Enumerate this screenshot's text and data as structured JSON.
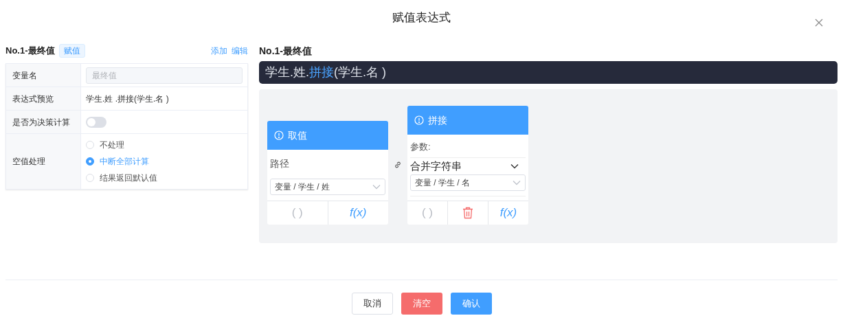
{
  "dialog": {
    "title": "赋值表达式"
  },
  "left": {
    "title": "No.1-最终值",
    "tag": "赋值",
    "actions": [
      "添加",
      "编辑"
    ],
    "rows": [
      {
        "kind": "input",
        "label": "变量名",
        "placeholder": "最终值"
      },
      {
        "kind": "text",
        "label": "表达式预览",
        "value": "学生.姓 .拼接(学生.名 )"
      },
      {
        "kind": "switch",
        "label": "是否为决策计算",
        "on": false
      },
      {
        "kind": "radio",
        "label": "空值处理",
        "options": [
          {
            "label": "不处理",
            "selected": false
          },
          {
            "label": "中断全部计算",
            "selected": true
          },
          {
            "label": "结果返回默认值",
            "selected": false
          }
        ]
      }
    ]
  },
  "right": {
    "title": "No.1-最终值",
    "expression": [
      {
        "kind": "plain",
        "text": "学生.姓."
      },
      {
        "kind": "func",
        "text": "拼接"
      },
      {
        "kind": "plain",
        "text": "(学生.名 )"
      }
    ],
    "cards": [
      {
        "kind": "value",
        "header": "取值",
        "field_label": "路径",
        "select": "变量 / 学生 / 姓",
        "footer": [
          {
            "kind": "paren",
            "text": "( )"
          },
          {
            "kind": "fx",
            "text": "f(x)"
          }
        ]
      },
      {
        "kind": "function",
        "header": "拼接",
        "field_label": "参数:",
        "method": "合并字符串",
        "select": "变量 / 学生 / 名",
        "footer": [
          {
            "kind": "paren",
            "text": "( )"
          },
          {
            "kind": "delete"
          },
          {
            "kind": "fx",
            "text": "f(x)"
          }
        ]
      }
    ]
  },
  "buttons": [
    {
      "kind": "default",
      "label": "取消"
    },
    {
      "kind": "danger",
      "label": "清空"
    },
    {
      "kind": "primary",
      "label": "确认"
    }
  ]
}
